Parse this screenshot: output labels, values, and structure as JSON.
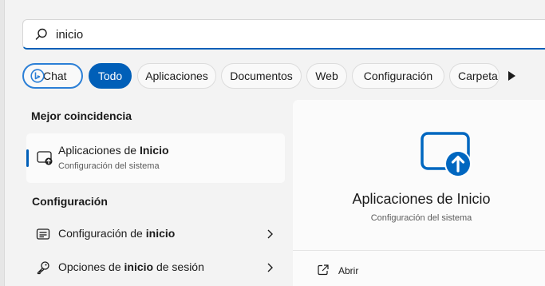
{
  "search": {
    "query": "inicio"
  },
  "filters": {
    "chat": "Chat",
    "items": [
      "Todo",
      "Aplicaciones",
      "Documentos",
      "Web",
      "Configuración",
      "Carpeta"
    ]
  },
  "best_match": {
    "title": "Mejor coincidencia",
    "item": {
      "name_prefix": "Aplicaciones de ",
      "name_bold": "Inicio",
      "subtitle": "Configuración del sistema"
    }
  },
  "settings_section": {
    "title": "Configuración",
    "items": [
      {
        "prefix": "Configuración de ",
        "bold": "inicio",
        "suffix": "",
        "icon": "settings-panel-icon"
      },
      {
        "prefix": "Opciones de ",
        "bold": "inicio",
        "suffix": " de sesión",
        "icon": "key-icon"
      }
    ]
  },
  "preview": {
    "title": "Aplicaciones de Inicio",
    "subtitle": "Configuración del sistema",
    "action": "Abrir"
  },
  "colors": {
    "accent": "#005fb8",
    "icon_blue": "#0067c0"
  }
}
